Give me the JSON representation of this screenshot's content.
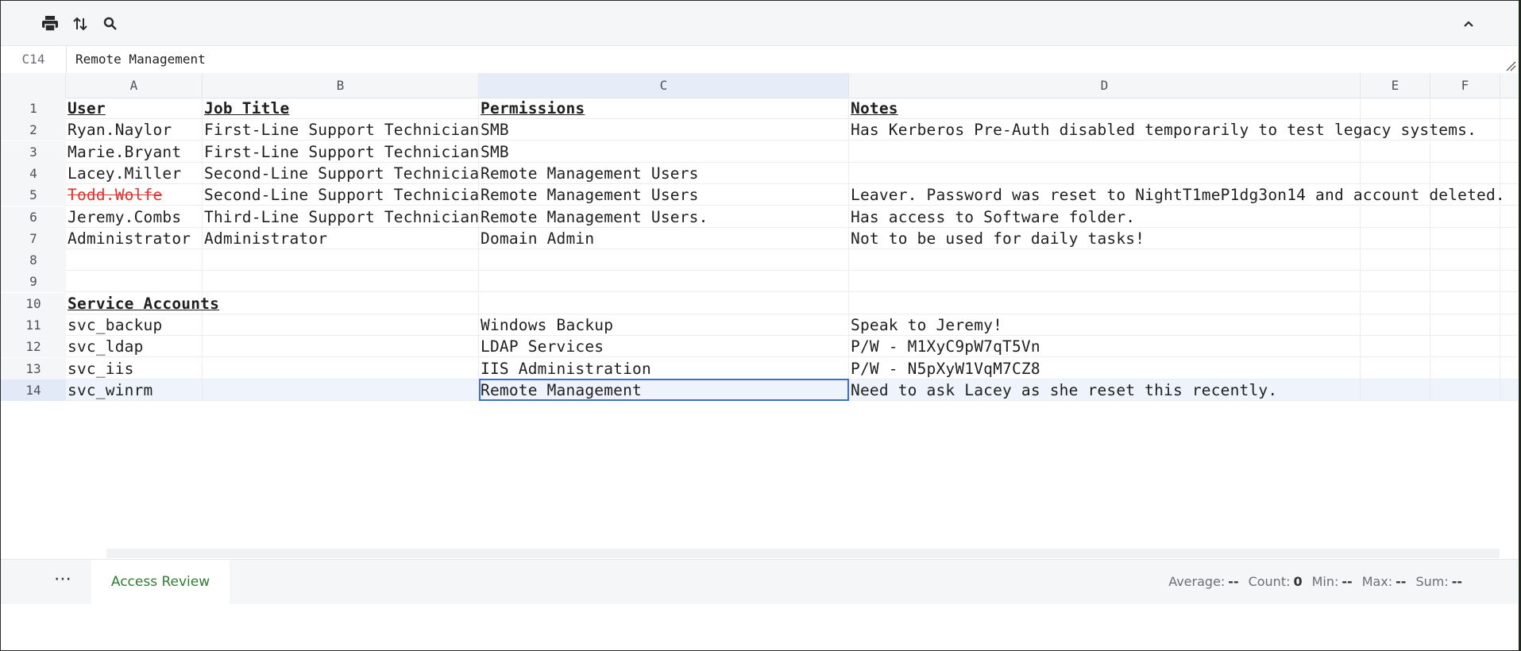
{
  "toolbar": {
    "icons": [
      "print-icon",
      "sort-icon",
      "search-icon",
      "chevron-up-icon"
    ]
  },
  "formula_bar": {
    "cell_ref": "C14",
    "value": "Remote Management"
  },
  "columns": [
    "A",
    "B",
    "C",
    "D",
    "E",
    "F"
  ],
  "active_column": "C",
  "active_row": "14",
  "rows": [
    {
      "n": "1",
      "a": "User",
      "b": "Job Title",
      "c": "Permissions",
      "d": "Notes"
    },
    {
      "n": "2",
      "a": "Ryan.Naylor",
      "b": "First-Line Support Technician",
      "c": "SMB",
      "d": "Has Kerberos Pre-Auth disabled temporarily to test legacy systems."
    },
    {
      "n": "3",
      "a": "Marie.Bryant",
      "b": "First-Line Support Technician",
      "c": "SMB",
      "d": ""
    },
    {
      "n": "4",
      "a": "Lacey.Miller",
      "b": "Second-Line Support Technician",
      "c": "Remote Management Users",
      "d": ""
    },
    {
      "n": "5",
      "a": "Todd.Wolfe",
      "b": "Second-Line Support Technician",
      "c": "Remote Management Users",
      "d": "Leaver. Password was reset to NightT1meP1dg3on14 and account deleted."
    },
    {
      "n": "6",
      "a": "Jeremy.Combs",
      "b": "Third-Line Support Technician",
      "c": "Remote Management Users.",
      "d": "Has access to Software folder."
    },
    {
      "n": "7",
      "a": "Administrator",
      "b": "Administrator",
      "c": "Domain Admin",
      "d": "Not to be used for daily tasks!"
    },
    {
      "n": "8",
      "a": "",
      "b": "",
      "c": "",
      "d": ""
    },
    {
      "n": "9",
      "a": "",
      "b": "",
      "c": "",
      "d": ""
    },
    {
      "n": "10",
      "a": "Service Accounts",
      "b": "",
      "c": "",
      "d": ""
    },
    {
      "n": "11",
      "a": "svc_backup",
      "b": "",
      "c": "Windows Backup",
      "d": "Speak to Jeremy!"
    },
    {
      "n": "12",
      "a": "svc_ldap",
      "b": "",
      "c": "LDAP Services",
      "d": "P/W - M1XyC9pW7qT5Vn"
    },
    {
      "n": "13",
      "a": "svc_iis",
      "b": "",
      "c": "IIS Administration",
      "d": "P/W - N5pXyW1VqM7CZ8"
    },
    {
      "n": "14",
      "a": "svc_winrm",
      "b": "",
      "c": "Remote Management",
      "d": "Need to ask Lacey as she reset this recently."
    }
  ],
  "sheet_bar": {
    "more_label": "⋯",
    "tab_label": "Access Review",
    "stats": [
      {
        "label": "Average:",
        "value": "--"
      },
      {
        "label": "Count:",
        "value": "0"
      },
      {
        "label": "Min:",
        "value": "--"
      },
      {
        "label": "Max:",
        "value": "--"
      },
      {
        "label": "Sum:",
        "value": "--"
      }
    ]
  },
  "colors": {
    "accent": "#3b6fd4",
    "tab_text": "#2e7d32",
    "strike_text": "#e0312f"
  }
}
